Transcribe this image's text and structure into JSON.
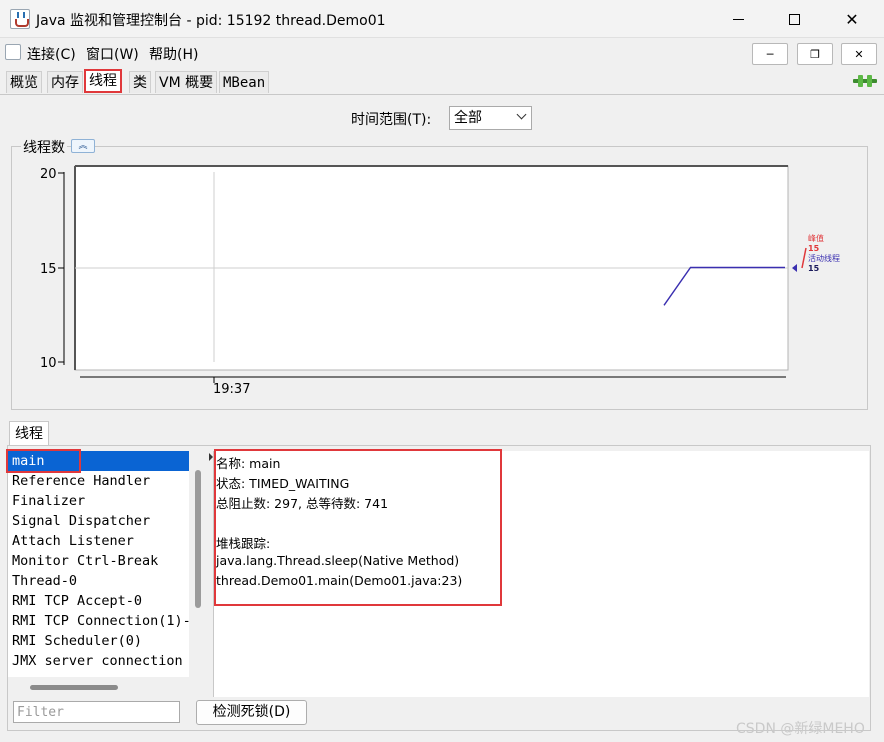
{
  "window": {
    "title": "Java 监视和管理控制台 - pid: 15192 thread.Demo01",
    "min_glyph": "",
    "close_glyph": "✕"
  },
  "menu": {
    "connect": "连接(C)",
    "window": "窗口(W)",
    "help": "帮助(H)"
  },
  "internal_frame": {
    "min": "─",
    "restore": "❐",
    "close": "✕"
  },
  "tabs": {
    "overview": "概览",
    "memory": "内存",
    "threads": "线程",
    "classes": "类",
    "vm": "VM 概要",
    "mbean": "MBean"
  },
  "time_range": {
    "label": "时间范围(T):",
    "value": "全部"
  },
  "chart_panel": {
    "title": "线程数",
    "collapse_glyph": "︽"
  },
  "chart_data": {
    "type": "line",
    "title": "",
    "ylim": [
      10,
      20
    ],
    "y_ticks": [
      "20",
      "15",
      "10"
    ],
    "x_tick": "19:37",
    "series": [
      {
        "name": "峰值",
        "color": "#e0383b",
        "latest": "15"
      },
      {
        "name": "活动线程",
        "color": "#3a2fb0",
        "latest": "15",
        "points": [
          [
            0,
            13
          ],
          [
            1,
            15
          ],
          [
            5,
            15
          ]
        ]
      }
    ],
    "grid": true,
    "legend": "right"
  },
  "threads": {
    "tab_label": "线程",
    "items": [
      "main",
      "Reference Handler",
      "Finalizer",
      "Signal Dispatcher",
      "Attach Listener",
      "Monitor Ctrl-Break",
      "Thread-0",
      "RMI TCP Accept-0",
      "RMI TCP Connection(1)-",
      "RMI Scheduler(0)",
      "JMX server connection"
    ],
    "selected": "main",
    "filter_placeholder": "Filter",
    "detect_deadlock": "检测死锁(D)"
  },
  "details": {
    "name_line": "名称: main",
    "state_line": "状态: TIMED_WAITING",
    "counts_line": "总阻止数: 297, 总等待数: 741",
    "stack_header": "堆栈跟踪:",
    "stack": [
      "java.lang.Thread.sleep(Native Method)",
      "thread.Demo01.main(Demo01.java:23)"
    ]
  },
  "watermark": "CSDN @新绿MEHO",
  "colors": {
    "selection": "#0a64d3",
    "highlight_box": "#e0383b",
    "active_series": "#3a2fb0",
    "peak_series": "#e0383b"
  }
}
